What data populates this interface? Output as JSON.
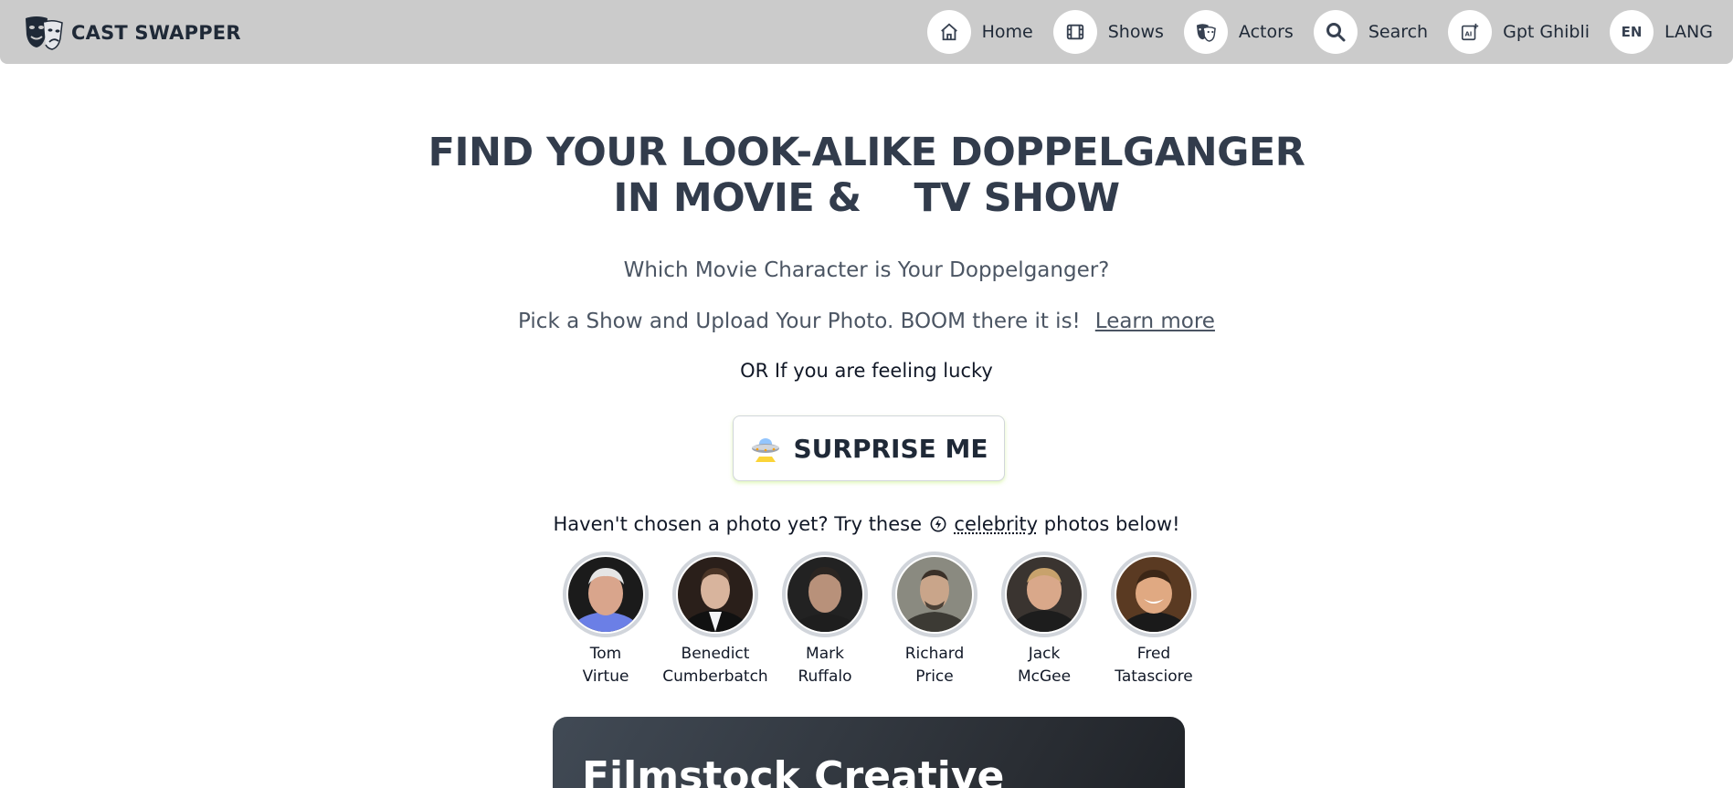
{
  "brand": {
    "name": "CAST SWAPPER"
  },
  "nav": {
    "items": [
      {
        "label": "Home",
        "icon": "home-icon"
      },
      {
        "label": "Shows",
        "icon": "film-icon"
      },
      {
        "label": "Actors",
        "icon": "masks-icon"
      },
      {
        "label": "Search",
        "icon": "search-icon"
      },
      {
        "label": "Gpt Ghibli",
        "icon": "ai-image-icon"
      },
      {
        "label": "LANG",
        "icon": "language-icon",
        "code": "EN"
      }
    ]
  },
  "hero": {
    "title_line1": "FIND YOUR LOOK-ALIKE DOPPELGANGER",
    "title_line2": "IN MOVIE &    TV SHOW",
    "subtitle": "Which Movie Character is Your Doppelganger?",
    "instructions": "Pick a Show and Upload Your Photo. BOOM there it is!",
    "learn_more": "Learn more",
    "lucky": "OR If you are feeling lucky",
    "surprise_label": "SURPRISE ME",
    "surprise_icon": "ufo-icon"
  },
  "celebrities": {
    "hint_before": "Haven't chosen a photo yet? Try these",
    "hint_link": "celebrity",
    "hint_after": "photos below!",
    "people": [
      {
        "first": "Tom",
        "last": "Virtue"
      },
      {
        "first": "Benedict",
        "last": "Cumberbatch"
      },
      {
        "first": "Mark",
        "last": "Ruffalo"
      },
      {
        "first": "Richard",
        "last": "Price"
      },
      {
        "first": "Jack",
        "last": "McGee"
      },
      {
        "first": "Fred",
        "last": "Tatasciore"
      }
    ]
  },
  "card": {
    "title": "Filmstock Creative"
  },
  "colors": {
    "navbar": "#cbcbcb",
    "title": "#323c4c",
    "text": "#1f2937",
    "ring": "#d1d5db"
  }
}
